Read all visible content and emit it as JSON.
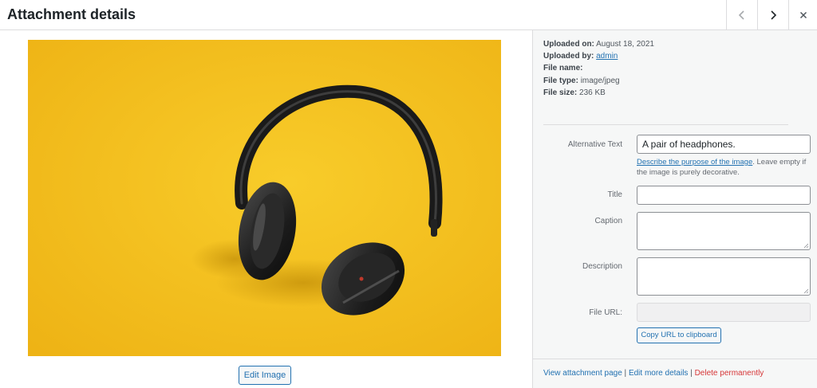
{
  "header": {
    "title": "Attachment details",
    "prev_icon": "chevron-left-icon",
    "next_icon": "chevron-right-icon",
    "close_icon": "close-icon"
  },
  "media": {
    "image_alt": "A pair of headphones.",
    "edit_image_label": "Edit Image"
  },
  "meta": {
    "uploaded_on_label": "Uploaded on:",
    "uploaded_on_value": "August 18, 2021",
    "uploaded_by_label": "Uploaded by:",
    "uploaded_by_value": "admin",
    "file_name_label": "File name:",
    "file_type_label": "File type:",
    "file_type_value": "image/jpeg",
    "file_size_label": "File size:",
    "file_size_value": "236 KB"
  },
  "form": {
    "alt_label": "Alternative Text",
    "alt_value": "A pair of headphones.",
    "help_link": "Describe the purpose of the image",
    "help_text": ". Leave empty if the image is purely decorative.",
    "title_label": "Title",
    "title_value": "",
    "caption_label": "Caption",
    "caption_value": "",
    "description_label": "Description",
    "description_value": "",
    "file_url_label": "File URL:",
    "copy_url_label": "Copy URL to clipboard"
  },
  "footer": {
    "view_link": "View attachment page",
    "sep1": " | ",
    "edit_link": "Edit more details",
    "sep2": " | ",
    "delete_link": "Delete permanently"
  },
  "colors": {
    "accent": "#2271b1",
    "danger": "#d63638",
    "image_background": "#f5c21a"
  }
}
